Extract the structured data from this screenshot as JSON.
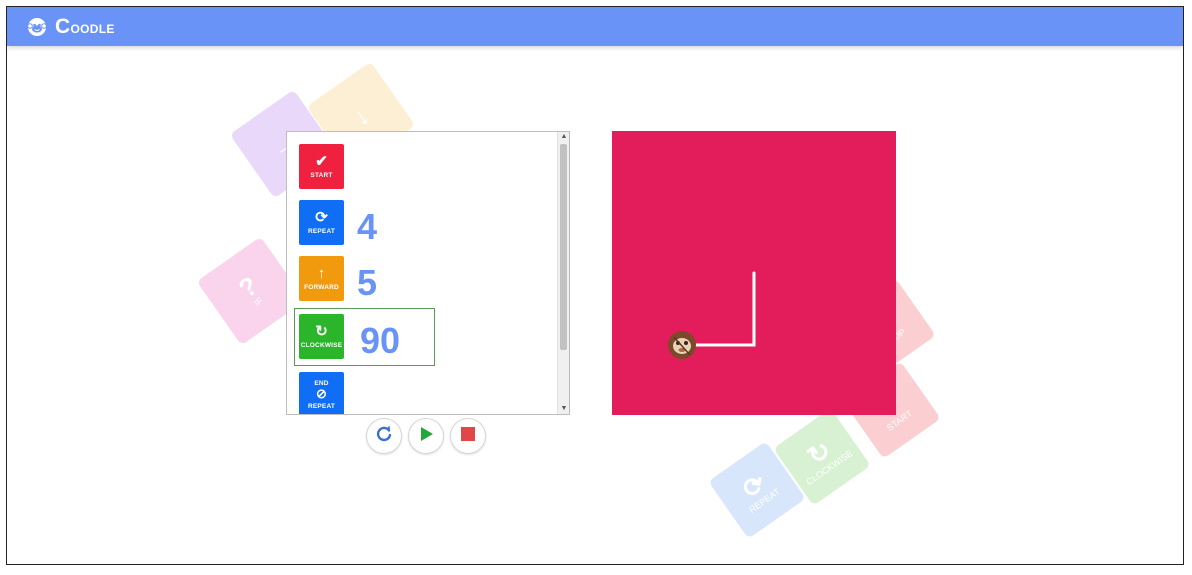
{
  "app": {
    "brand": "Coodle",
    "logo_icon": "monkey-face-icon"
  },
  "colors": {
    "header": "#6a93f7",
    "start": "#f0213f",
    "repeat": "#0f6ef5",
    "forward": "#f29a0e",
    "clockwise": "#2ab52a",
    "stage": "#e31c5b",
    "param": "#6a93f7"
  },
  "program": {
    "blocks": [
      {
        "label": "START",
        "icon": "checkmark-icon",
        "param": ""
      },
      {
        "label": "REPEAT",
        "icon": "repeat-icon",
        "param": "4"
      },
      {
        "label": "FORWARD",
        "icon": "arrow-up-icon",
        "param": "5"
      },
      {
        "label": "CLOCKWISE",
        "icon": "rotate-clockwise-icon",
        "param": "90"
      },
      {
        "label_top": "END",
        "label": "REPEAT",
        "icon": "no-repeat-icon",
        "param": ""
      }
    ],
    "selected_index": 3
  },
  "controls": [
    {
      "name": "reset",
      "icon": "refresh-icon"
    },
    {
      "name": "run",
      "icon": "play-icon"
    },
    {
      "name": "stop",
      "icon": "stop-icon"
    }
  ],
  "background_cards": [
    {
      "label": "?",
      "sub": "IF"
    },
    {
      "label": "CLOCKWISE"
    },
    {
      "label": "REPEAT"
    },
    {
      "label": "START"
    },
    {
      "label": "STOP"
    }
  ]
}
